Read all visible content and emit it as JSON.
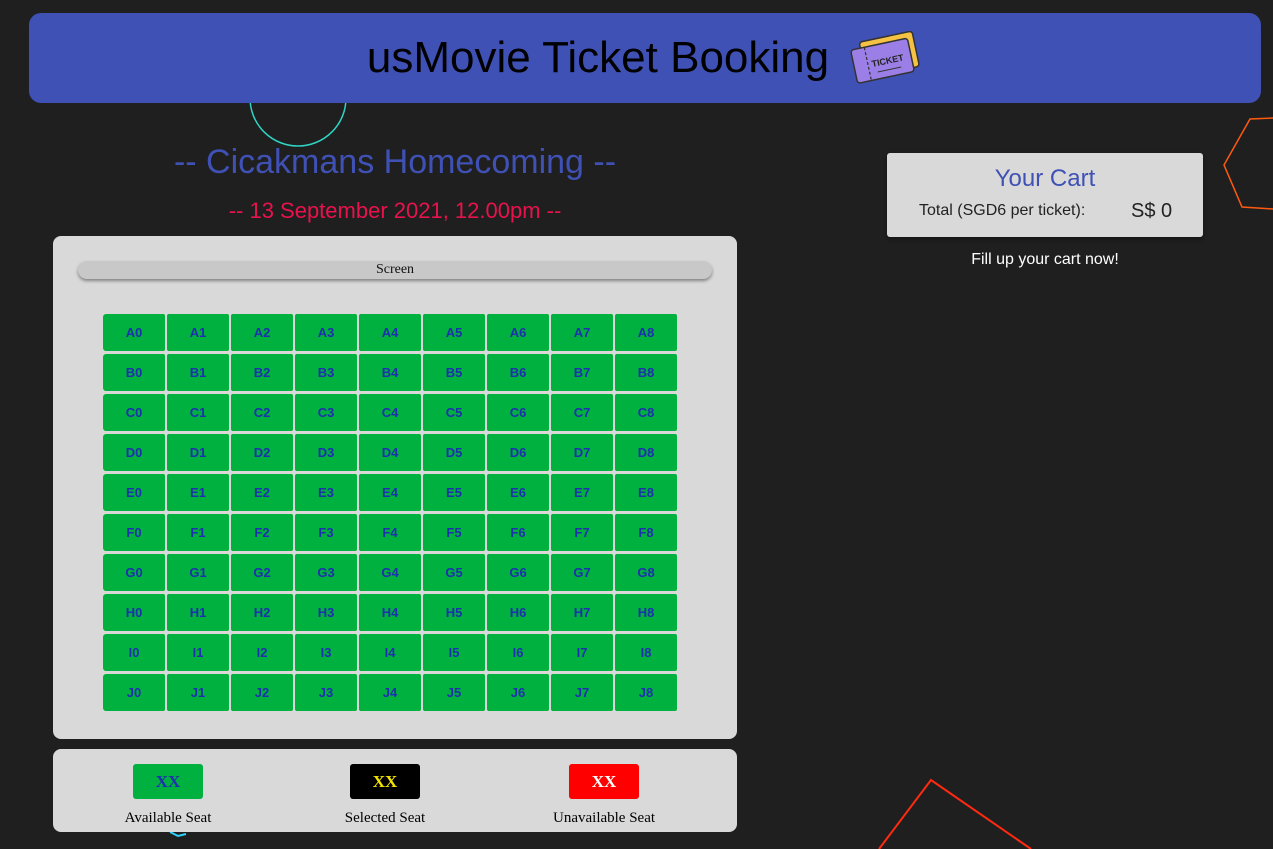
{
  "header": {
    "title": "usMovie Ticket Booking",
    "icon": "ticket-icon",
    "icon_text": "TICKET"
  },
  "movie": {
    "title": "-- Cicakmans Homecoming --",
    "date": "-- 13 September 2021, 12.00pm --"
  },
  "screen_label": "Screen",
  "seats": {
    "rows": [
      "A",
      "B",
      "C",
      "D",
      "E",
      "F",
      "G",
      "H",
      "I",
      "J"
    ],
    "columns": [
      0,
      1,
      2,
      3,
      4,
      5,
      6,
      7,
      8
    ],
    "status": "available"
  },
  "legend": {
    "available": {
      "sample": "XX",
      "label": "Available Seat"
    },
    "selected": {
      "sample": "XX",
      "label": "Selected Seat"
    },
    "unavailable": {
      "sample": "XX",
      "label": "Unavailable Seat"
    }
  },
  "cart": {
    "title": "Your Cart",
    "total_label": "Total (SGD6 per ticket):",
    "total_value": "S$ 0",
    "empty_message": "Fill up your cart now!"
  },
  "colors": {
    "background": "#1f1f1f",
    "primary": "#3f51b5",
    "date_accent": "#e8124c",
    "available": "#00b140",
    "selected": "#000000",
    "unavailable": "#ff0000",
    "panel": "#d9d9d9"
  }
}
